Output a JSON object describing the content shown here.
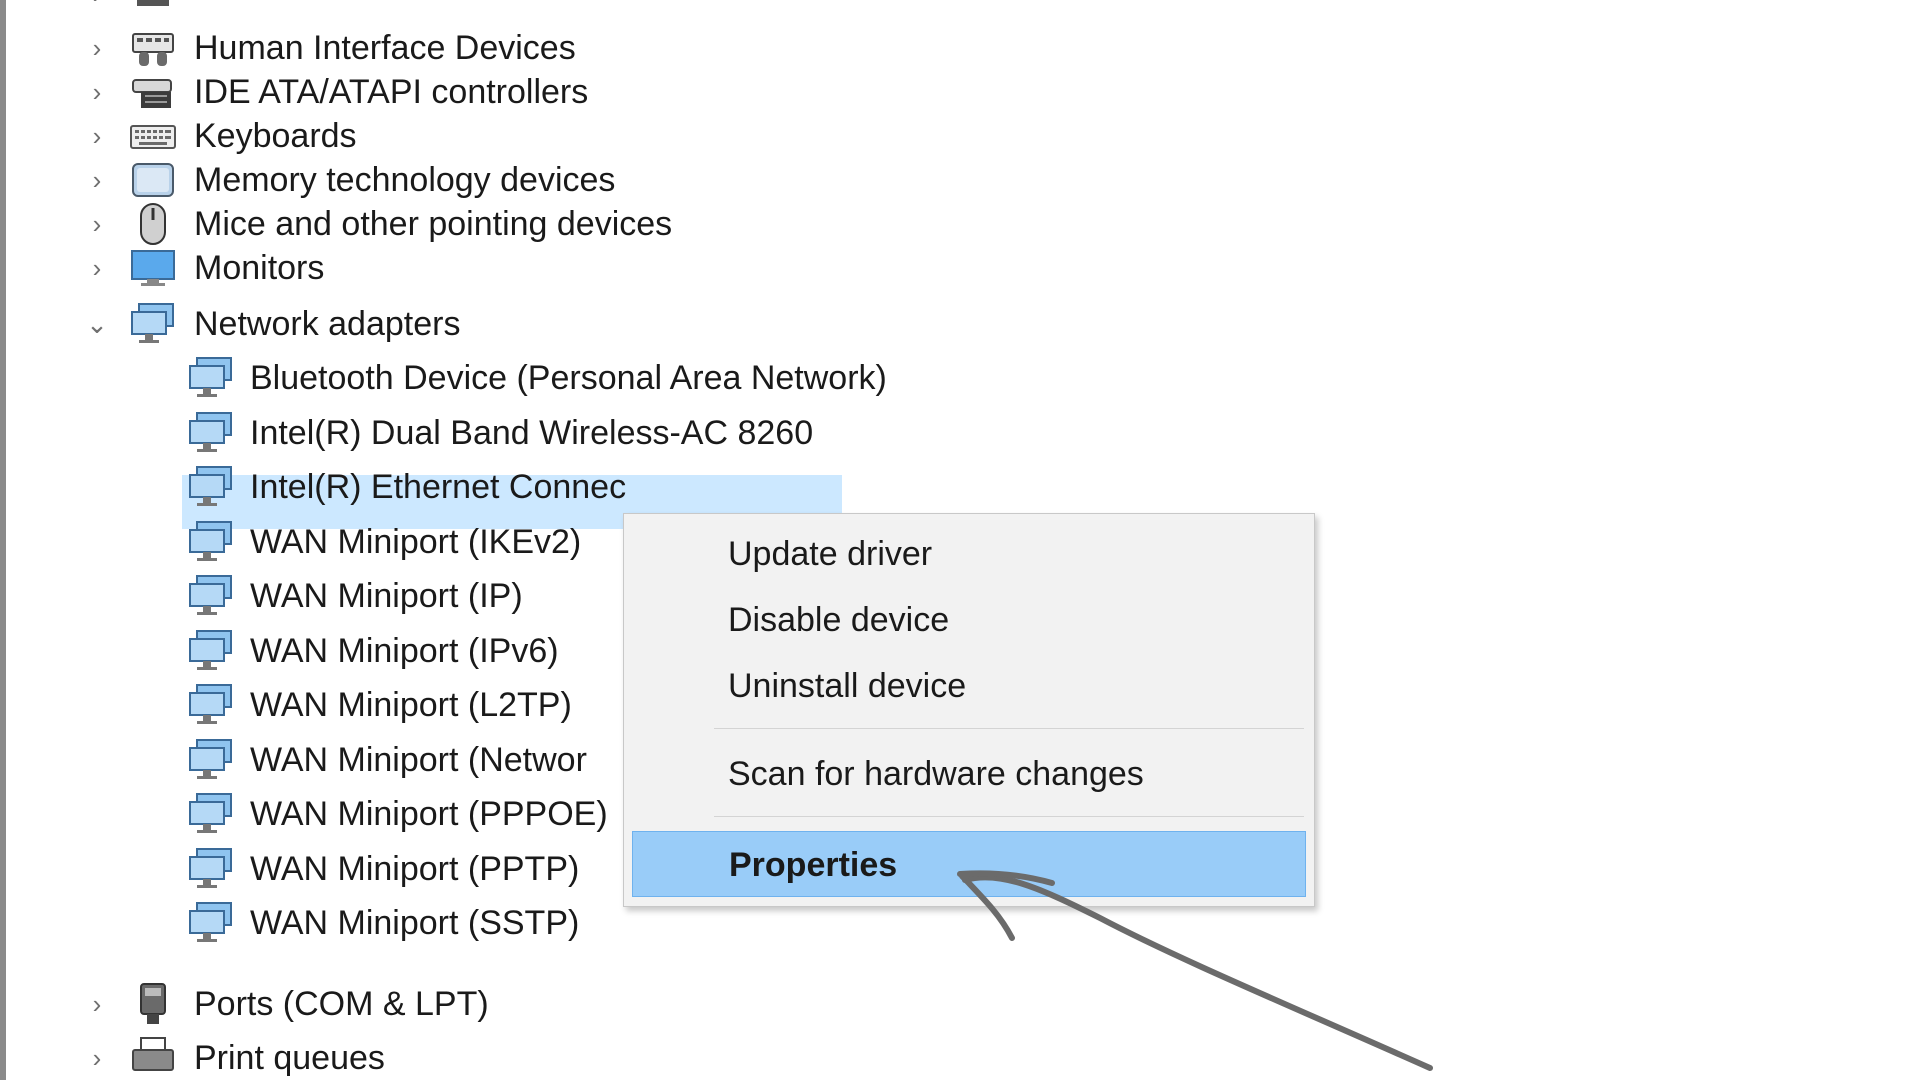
{
  "tree": {
    "categories_top": [
      {
        "label": "Human Interface Devices",
        "icon": "hid-icon"
      },
      {
        "label": "IDE ATA/ATAPI controllers",
        "icon": "ide-controller-icon"
      },
      {
        "label": "Keyboards",
        "icon": "keyboard-icon"
      },
      {
        "label": "Memory technology devices",
        "icon": "memory-card-icon"
      },
      {
        "label": "Mice and other pointing devices",
        "icon": "mouse-icon"
      },
      {
        "label": "Monitors",
        "icon": "monitor-icon"
      }
    ],
    "network": {
      "label": "Network adapters",
      "icon": "network-adapter-icon",
      "expanded": true,
      "children": [
        "Bluetooth Device (Personal Area Network)",
        "Intel(R) Dual Band Wireless-AC 8260",
        "Intel(R) Ethernet Connec",
        "WAN Miniport (IKEv2)",
        "WAN Miniport (IP)",
        "WAN Miniport (IPv6)",
        "WAN Miniport (L2TP)",
        "WAN Miniport (Networ",
        "WAN Miniport (PPPOE)",
        "WAN Miniport (PPTP)",
        "WAN Miniport (SSTP)"
      ],
      "selected_child_index": 2
    },
    "categories_bottom": [
      {
        "label": "Ports (COM & LPT)",
        "icon": "port-icon"
      },
      {
        "label": "Print queues",
        "icon": "printer-icon"
      }
    ]
  },
  "context_menu": {
    "items": [
      "Update driver",
      "Disable device",
      "Uninstall device",
      "Scan for hardware changes",
      "Properties"
    ],
    "highlighted": "Properties"
  },
  "colors": {
    "selection": "#cce8ff",
    "menu_bg": "#f2f2f2",
    "menu_highlight": "#99ccf8",
    "annotation_arrow": "#6b6b6b"
  }
}
